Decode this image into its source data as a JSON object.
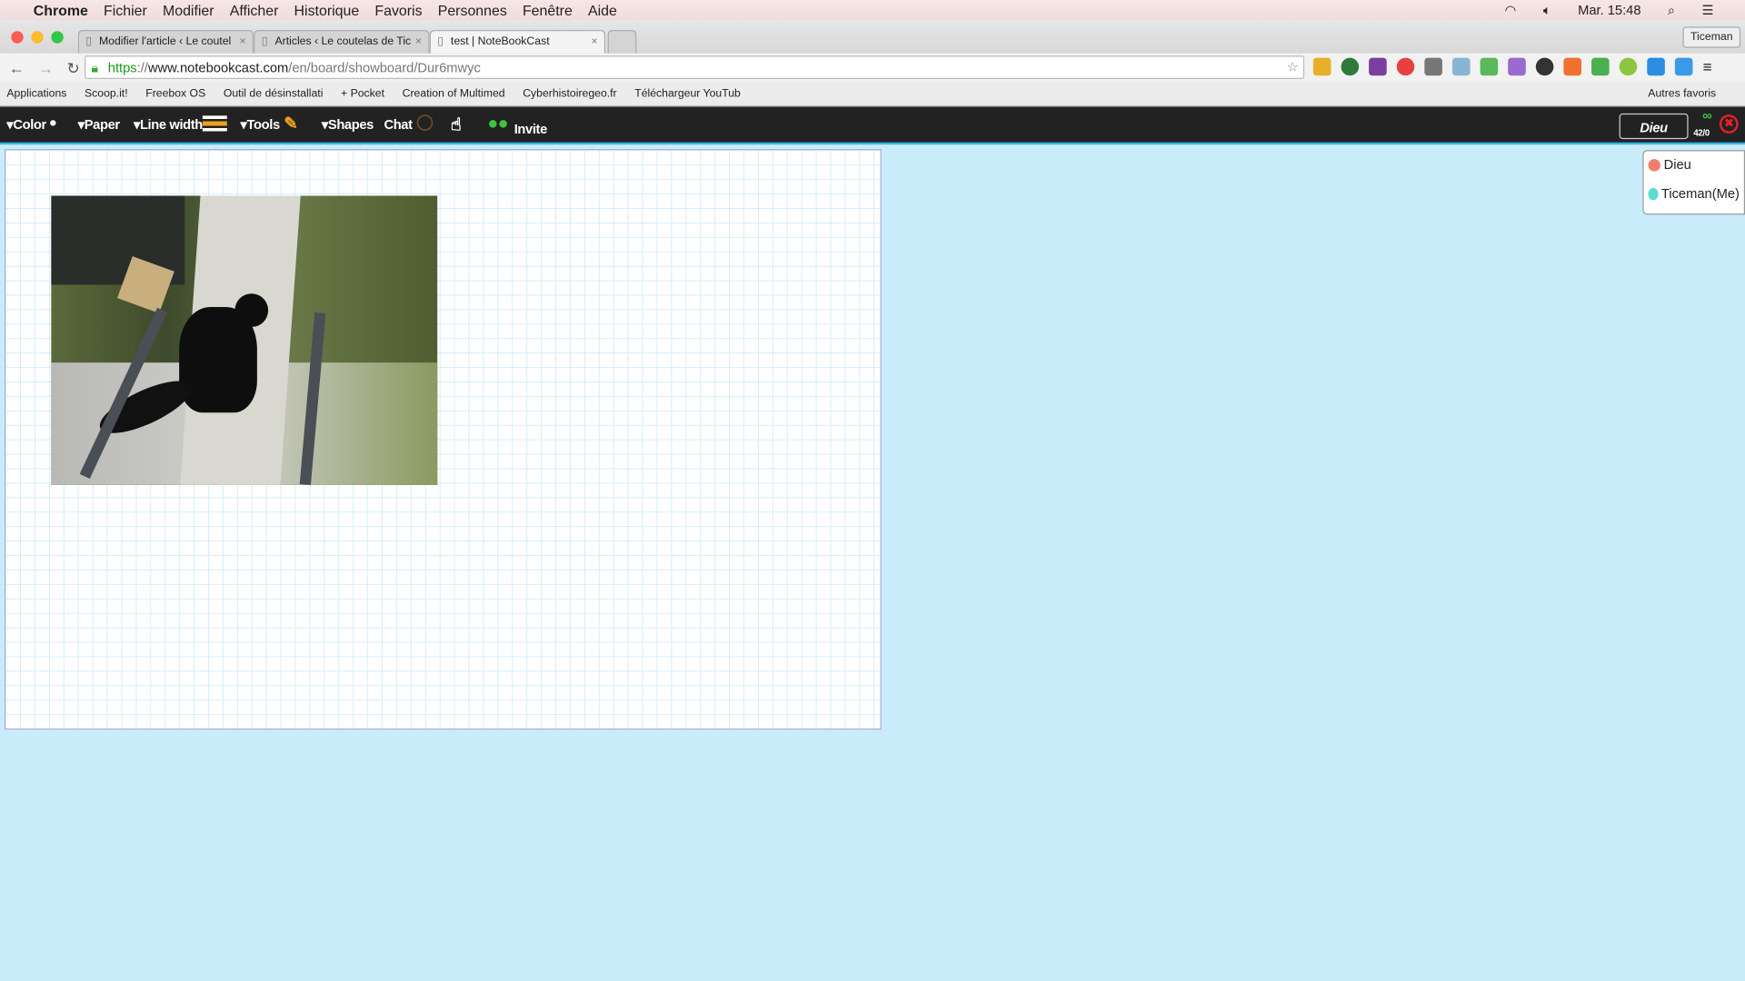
{
  "menubar": {
    "app": "Chrome",
    "items": [
      "Fichier",
      "Modifier",
      "Afficher",
      "Historique",
      "Favoris",
      "Personnes",
      "Fenêtre",
      "Aide"
    ],
    "clock": "Mar. 15:48"
  },
  "tabs": [
    {
      "title": "Modifier l'article ‹ Le coutel"
    },
    {
      "title": "Articles ‹ Le coutelas de Tic"
    },
    {
      "title": "test | NoteBookCast",
      "active": true
    }
  ],
  "profile": "Ticeman",
  "url": {
    "scheme": "https",
    "sep": "://",
    "host": "www.notebookcast.com",
    "path": "/en/board/showboard/Dur6mwyc"
  },
  "bookmarks": [
    "Applications",
    "Scoop.it!",
    "Freebox OS",
    "Outil de désinstallati",
    "+ Pocket",
    "Creation of Multimed",
    "Cyberhistoiregeo.fr",
    "Téléchargeur YouTub"
  ],
  "other_bookmarks": "Autres favoris",
  "appbar": {
    "color": "▾Color",
    "paper": "▾Paper",
    "line_width": "▾Line width",
    "tools": "▾Tools",
    "shapes": "▾Shapes",
    "chat": "Chat",
    "invite": "Invite",
    "user_name": "Dieu",
    "count": "42/0"
  },
  "users": [
    {
      "name": "Dieu",
      "color": "#f47c6a"
    },
    {
      "name": "Ticeman(Me)",
      "color": "#5ddcd4"
    }
  ],
  "colors": {
    "accent": "#35b6e6",
    "invite": "#3cc83c",
    "close": "#e0202a"
  }
}
